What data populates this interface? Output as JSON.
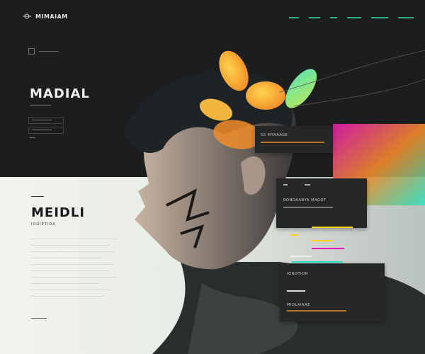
{
  "brand": {
    "logo_text": "MIMAIAM"
  },
  "nav": {
    "items": [
      "",
      "",
      "",
      "",
      "",
      ""
    ]
  },
  "hero_top": {
    "title": "MADIAL"
  },
  "hero_bottom": {
    "title": "MEIDLI",
    "subtitle": "IOUIETIOA"
  },
  "cards": {
    "card1_title": "50  MYAAAGE",
    "card2_title": "BONDAANYA  MAGOT",
    "card3_title": "IONOTION",
    "card4_title": "MIOLAIAAE"
  },
  "colors": {
    "accent_teal": "#3ad2a3",
    "accent_yellow": "#ffd21e",
    "accent_magenta": "#e21ab8",
    "accent_orange": "#f59a2a",
    "accent_cyan": "#25e6c6",
    "dark_bg": "#1c1d1e",
    "card_bg": "#262729"
  },
  "icons": {
    "logo": "crosshair-icon",
    "breadcrumb": "square-icon"
  }
}
